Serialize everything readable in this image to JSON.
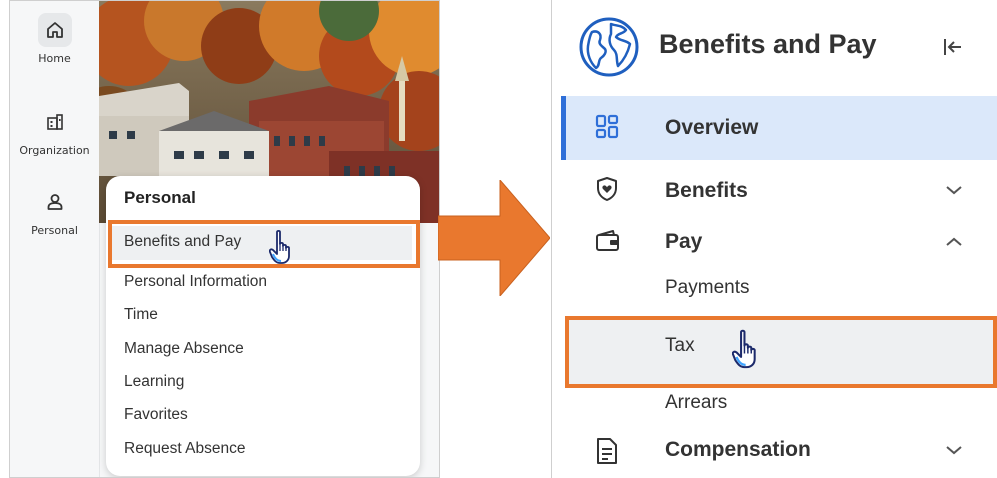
{
  "left": {
    "rail": [
      {
        "label": "Home",
        "icon": "home-icon",
        "active": true
      },
      {
        "label": "Organization",
        "icon": "organization-icon",
        "active": false
      },
      {
        "label": "Personal",
        "icon": "person-icon",
        "active": false
      }
    ],
    "menu": {
      "title": "Personal",
      "items": [
        "Benefits and Pay",
        "Personal Information",
        "Time",
        "Manage Absence",
        "Learning",
        "Favorites",
        "Request Absence"
      ]
    }
  },
  "right": {
    "title": "Benefits and Pay",
    "nav": {
      "overview": "Overview",
      "benefits": "Benefits",
      "pay": "Pay",
      "payments": "Payments",
      "tax": "Tax",
      "arrears": "Arrears",
      "compensation": "Compensation"
    }
  },
  "colors": {
    "highlight_orange": "#e9782e",
    "active_blue": "#2f6fd8",
    "overview_bg": "#dbe8fa"
  }
}
